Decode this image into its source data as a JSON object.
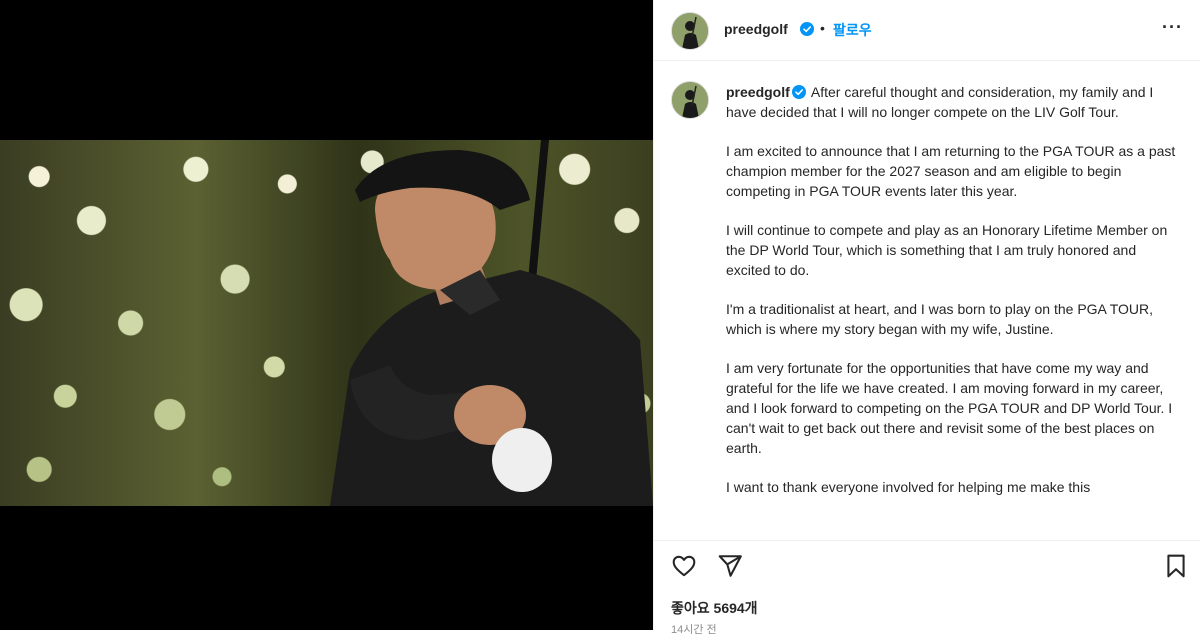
{
  "header": {
    "username": "preedgolf",
    "separator": "•",
    "follow_label": "팔로우",
    "more_label": "···"
  },
  "caption": {
    "username": "preedgolf",
    "paragraphs": [
      "After careful thought and consideration, my family and I have decided that I will no longer compete on the LIV Golf Tour.",
      "I am excited to announce that I am returning to the PGA TOUR as a past champion member for the 2027 season and am eligible to begin competing in PGA TOUR events later this year.",
      "I will continue to compete and play as an Honorary Lifetime Member on the DP World Tour, which is something that I am truly honored and excited to do.",
      "I'm a traditionalist at heart, and I was born to play on the PGA TOUR, which is where my story began with my wife, Justine.",
      "I am very fortunate for the opportunities that have come my way and grateful for the life we have created. I am moving forward in my career, and I look forward to competing on the PGA TOUR and DP World Tour. I can't wait to get back out there and revisit some of the best places on earth.",
      "I want to thank everyone involved for helping me make this"
    ]
  },
  "footer": {
    "likes": "좋아요 5694개",
    "time": "14시간 전"
  },
  "icons": {
    "verified": "verified-badge-icon",
    "heart": "heart-icon",
    "share": "share-icon",
    "bookmark": "bookmark-icon"
  },
  "colors": {
    "accent": "#0095f6",
    "text": "#262626",
    "muted": "#8e8e8e",
    "media_bg": "#000000"
  }
}
